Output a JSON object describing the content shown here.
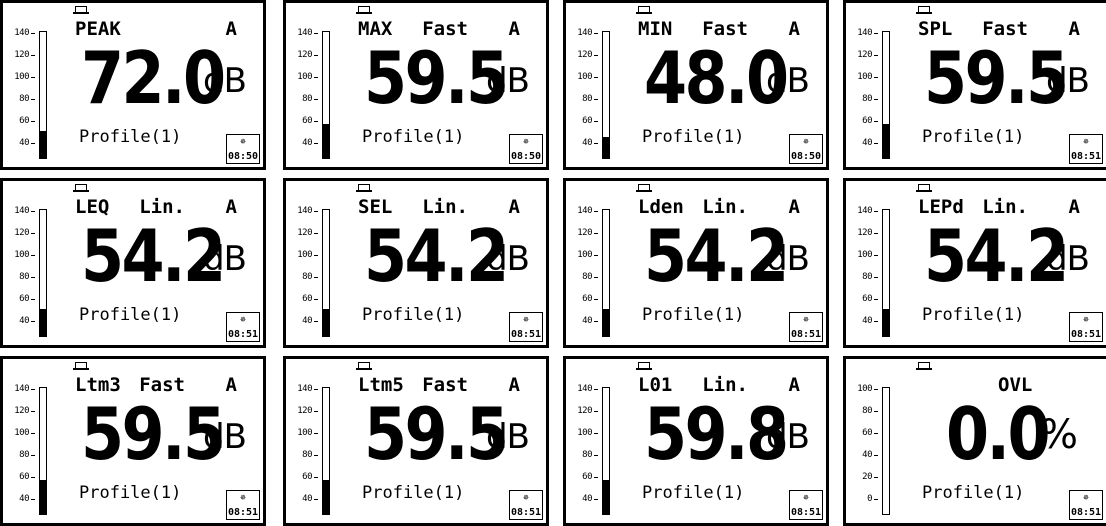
{
  "screens": [
    {
      "func": "PEAK",
      "mode": "",
      "weight": "A",
      "value": "72.0",
      "unit": "dB",
      "profile": "Profile(1)",
      "time": "08:50",
      "bar_level_db": 54
    },
    {
      "func": "MAX",
      "mode": "Fast",
      "weight": "A",
      "value": "59.5",
      "unit": "dB",
      "profile": "Profile(1)",
      "time": "08:50",
      "bar_level_db": 60
    },
    {
      "func": "MIN",
      "mode": "Fast",
      "weight": "A",
      "value": "48.0",
      "unit": "dB",
      "profile": "Profile(1)",
      "time": "08:50",
      "bar_level_db": 48
    },
    {
      "func": "SPL",
      "mode": "Fast",
      "weight": "A",
      "value": "59.5",
      "unit": "dB",
      "profile": "Profile(1)",
      "time": "08:51",
      "bar_level_db": 60
    },
    {
      "func": "LEQ",
      "mode": "Lin.",
      "weight": "A",
      "value": "54.2",
      "unit": "dB",
      "profile": "Profile(1)",
      "time": "08:51",
      "bar_level_db": 54
    },
    {
      "func": "SEL",
      "mode": "Lin.",
      "weight": "A",
      "value": "54.2",
      "unit": "dB",
      "profile": "Profile(1)",
      "time": "08:51",
      "bar_level_db": 54
    },
    {
      "func": "Lden",
      "mode": "Lin.",
      "weight": "A",
      "value": "54.2",
      "unit": "dB",
      "profile": "Profile(1)",
      "time": "08:51",
      "bar_level_db": 54
    },
    {
      "func": "LEPd",
      "mode": "Lin.",
      "weight": "A",
      "value": "54.2",
      "unit": "dB",
      "profile": "Profile(1)",
      "time": "08:51",
      "bar_level_db": 54
    },
    {
      "func": "Ltm3",
      "mode": "Fast",
      "weight": "A",
      "value": "59.5",
      "unit": "dB",
      "profile": "Profile(1)",
      "time": "08:51",
      "bar_level_db": 60
    },
    {
      "func": "Ltm5",
      "mode": "Fast",
      "weight": "A",
      "value": "59.5",
      "unit": "dB",
      "profile": "Profile(1)",
      "time": "08:51",
      "bar_level_db": 60
    },
    {
      "func": "L01",
      "mode": "Lin.",
      "weight": "A",
      "value": "59.8",
      "unit": "dB",
      "profile": "Profile(1)",
      "time": "08:51",
      "bar_level_db": 60
    },
    {
      "func": "OVL",
      "mode": "",
      "weight": "",
      "value": "0.0",
      "unit": "%",
      "profile": "Profile(1)",
      "time": "08:51",
      "bar_level_db": 0,
      "ovl": true
    }
  ],
  "scale_db": [
    "140",
    "120",
    "100",
    "80",
    "60",
    "40"
  ],
  "scale_percent": [
    "100",
    "80",
    "60",
    "40",
    "20",
    "0"
  ],
  "icons": {
    "memory": "memory-card-icon",
    "clock": "clock-icon"
  }
}
